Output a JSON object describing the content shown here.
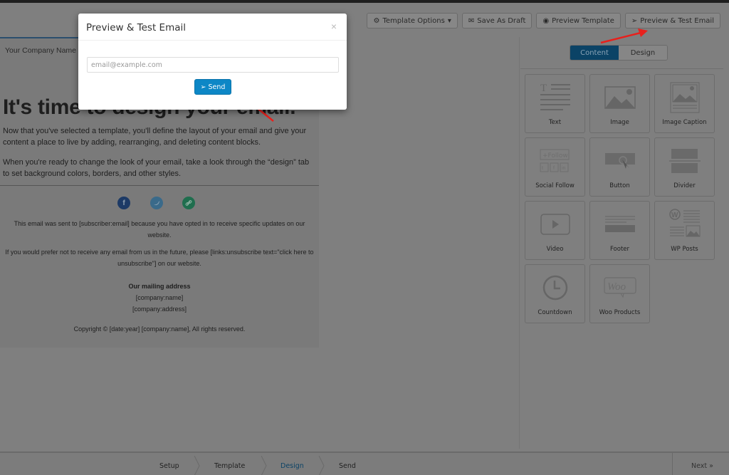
{
  "toolbar": {
    "template_options": "Template Options",
    "save_draft": "Save As Draft",
    "preview_template": "Preview Template",
    "preview_test": "Preview & Test Email"
  },
  "email": {
    "company_name": "Your Company Name",
    "headline": "It's time to design your email.",
    "para1": "Now that you've selected a template, you'll define the layout of your email and give your content a place to live by adding, rearranging, and deleting content blocks.",
    "para2": "When you're ready to change the look of your email, take a look through the “design” tab to set background colors, borders, and other styles.",
    "social": [
      {
        "name": "facebook",
        "glyph": "f",
        "color": "#1d3a66"
      },
      {
        "name": "twitter",
        "glyph": "t",
        "color": "#3a6a8a"
      },
      {
        "name": "link",
        "glyph": "∞",
        "color": "#1f6e4e"
      }
    ],
    "footer_sent": "This email was sent to [subscriber:email] because you have opted in to receive specific updates on our website.",
    "footer_unsub": "If you would prefer not to receive any email from us in the future, please [links:unsubscribe text=\"click here to unsubscribe\"] on our website.",
    "mailing_title": "Our mailing address",
    "mailing_name": "[company:name]",
    "mailing_address": "[company:address]",
    "copyright": "Copyright © [date:year] [company:name], All rights reserved."
  },
  "sidebar": {
    "tabs": [
      {
        "label": "Content",
        "active": true
      },
      {
        "label": "Design",
        "active": false
      }
    ],
    "blocks": [
      {
        "label": "Text",
        "icon": "text-icon"
      },
      {
        "label": "Image",
        "icon": "image-icon"
      },
      {
        "label": "Image Caption",
        "icon": "image-caption-icon"
      },
      {
        "label": "Social Follow",
        "icon": "social-follow-icon"
      },
      {
        "label": "Button",
        "icon": "button-icon"
      },
      {
        "label": "Divider",
        "icon": "divider-icon"
      },
      {
        "label": "Video",
        "icon": "video-icon"
      },
      {
        "label": "Footer",
        "icon": "footer-icon"
      },
      {
        "label": "WP Posts",
        "icon": "wp-posts-icon"
      },
      {
        "label": "Countdown",
        "icon": "countdown-icon"
      },
      {
        "label": "Woo Products",
        "icon": "woo-products-icon"
      }
    ]
  },
  "steps": {
    "items": [
      {
        "label": "Setup",
        "active": false
      },
      {
        "label": "Template",
        "active": false
      },
      {
        "label": "Design",
        "active": true
      },
      {
        "label": "Send",
        "active": false
      }
    ],
    "next_label": "Next »",
    "active_color": "#0b4366"
  },
  "modal": {
    "title": "Preview & Test Email",
    "close": "×",
    "email_value": "",
    "email_placeholder": "email@example.com",
    "send_label": "Send",
    "send_color": "#0d87c6"
  }
}
